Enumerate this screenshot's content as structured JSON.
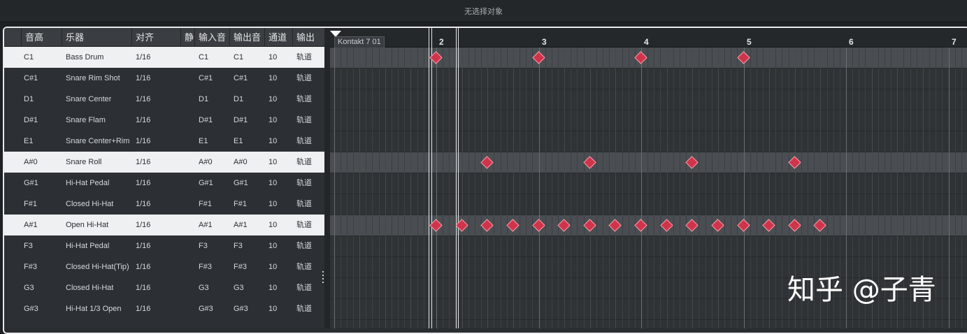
{
  "top_status": "无选择对象",
  "drum_list": {
    "headers": [
      "音高",
      "乐器",
      "对齐",
      "静",
      "输入音",
      "输出音",
      "通道",
      "输出"
    ],
    "selected_rows": [
      0,
      5,
      8
    ],
    "rows": [
      {
        "pitch": "C1",
        "instrument": "Bass Drum",
        "quantize": "1/16",
        "input": "C1",
        "output": "C1",
        "channel": "10",
        "out": "轨道"
      },
      {
        "pitch": "C#1",
        "instrument": "Snare Rim Shot",
        "quantize": "1/16",
        "input": "C#1",
        "output": "C#1",
        "channel": "10",
        "out": "轨道"
      },
      {
        "pitch": "D1",
        "instrument": "Snare Center",
        "quantize": "1/16",
        "input": "D1",
        "output": "D1",
        "channel": "10",
        "out": "轨道"
      },
      {
        "pitch": "D#1",
        "instrument": "Snare Flam",
        "quantize": "1/16",
        "input": "D#1",
        "output": "D#1",
        "channel": "10",
        "out": "轨道"
      },
      {
        "pitch": "E1",
        "instrument": "Snare Center+Rim",
        "quantize": "1/16",
        "input": "E1",
        "output": "E1",
        "channel": "10",
        "out": "轨道"
      },
      {
        "pitch": "A#0",
        "instrument": "Snare Roll",
        "quantize": "1/16",
        "input": "A#0",
        "output": "A#0",
        "channel": "10",
        "out": "轨道"
      },
      {
        "pitch": "G#1",
        "instrument": "Hi-Hat Pedal",
        "quantize": "1/16",
        "input": "G#1",
        "output": "G#1",
        "channel": "10",
        "out": "轨道"
      },
      {
        "pitch": "F#1",
        "instrument": "Closed Hi-Hat",
        "quantize": "1/16",
        "input": "F#1",
        "output": "F#1",
        "channel": "10",
        "out": "轨道"
      },
      {
        "pitch": "A#1",
        "instrument": "Open Hi-Hat",
        "quantize": "1/16",
        "input": "A#1",
        "output": "A#1",
        "channel": "10",
        "out": "轨道"
      },
      {
        "pitch": "F3",
        "instrument": "Hi-Hat Pedal",
        "quantize": "1/16",
        "input": "F3",
        "output": "F3",
        "channel": "10",
        "out": "轨道"
      },
      {
        "pitch": "F#3",
        "instrument": "Closed Hi-Hat(Tip)",
        "quantize": "1/16",
        "input": "F#3",
        "output": "F#3",
        "channel": "10",
        "out": "轨道"
      },
      {
        "pitch": "G3",
        "instrument": "Closed Hi-Hat",
        "quantize": "1/16",
        "input": "G3",
        "output": "G3",
        "channel": "10",
        "out": "轨道"
      },
      {
        "pitch": "G#3",
        "instrument": "Hi-Hat 1/3 Open",
        "quantize": "1/16",
        "input": "G#3",
        "output": "G#3",
        "channel": "10",
        "out": "轨道"
      }
    ]
  },
  "editor": {
    "part_label": "Kontakt 7 01",
    "bar_numbers": [
      "2",
      "3",
      "4",
      "5",
      "6",
      "7"
    ],
    "first_bar": 2,
    "notes": [
      {
        "row": 0,
        "beats": [
          0,
          4,
          8,
          12
        ]
      },
      {
        "row": 5,
        "beats": [
          2,
          6,
          10,
          14
        ]
      },
      {
        "row": 8,
        "beats": [
          0,
          1,
          2,
          3,
          4,
          5,
          6,
          7,
          8,
          9,
          10,
          11,
          12,
          13,
          14,
          15
        ]
      }
    ]
  },
  "watermark": "知乎 @子青"
}
